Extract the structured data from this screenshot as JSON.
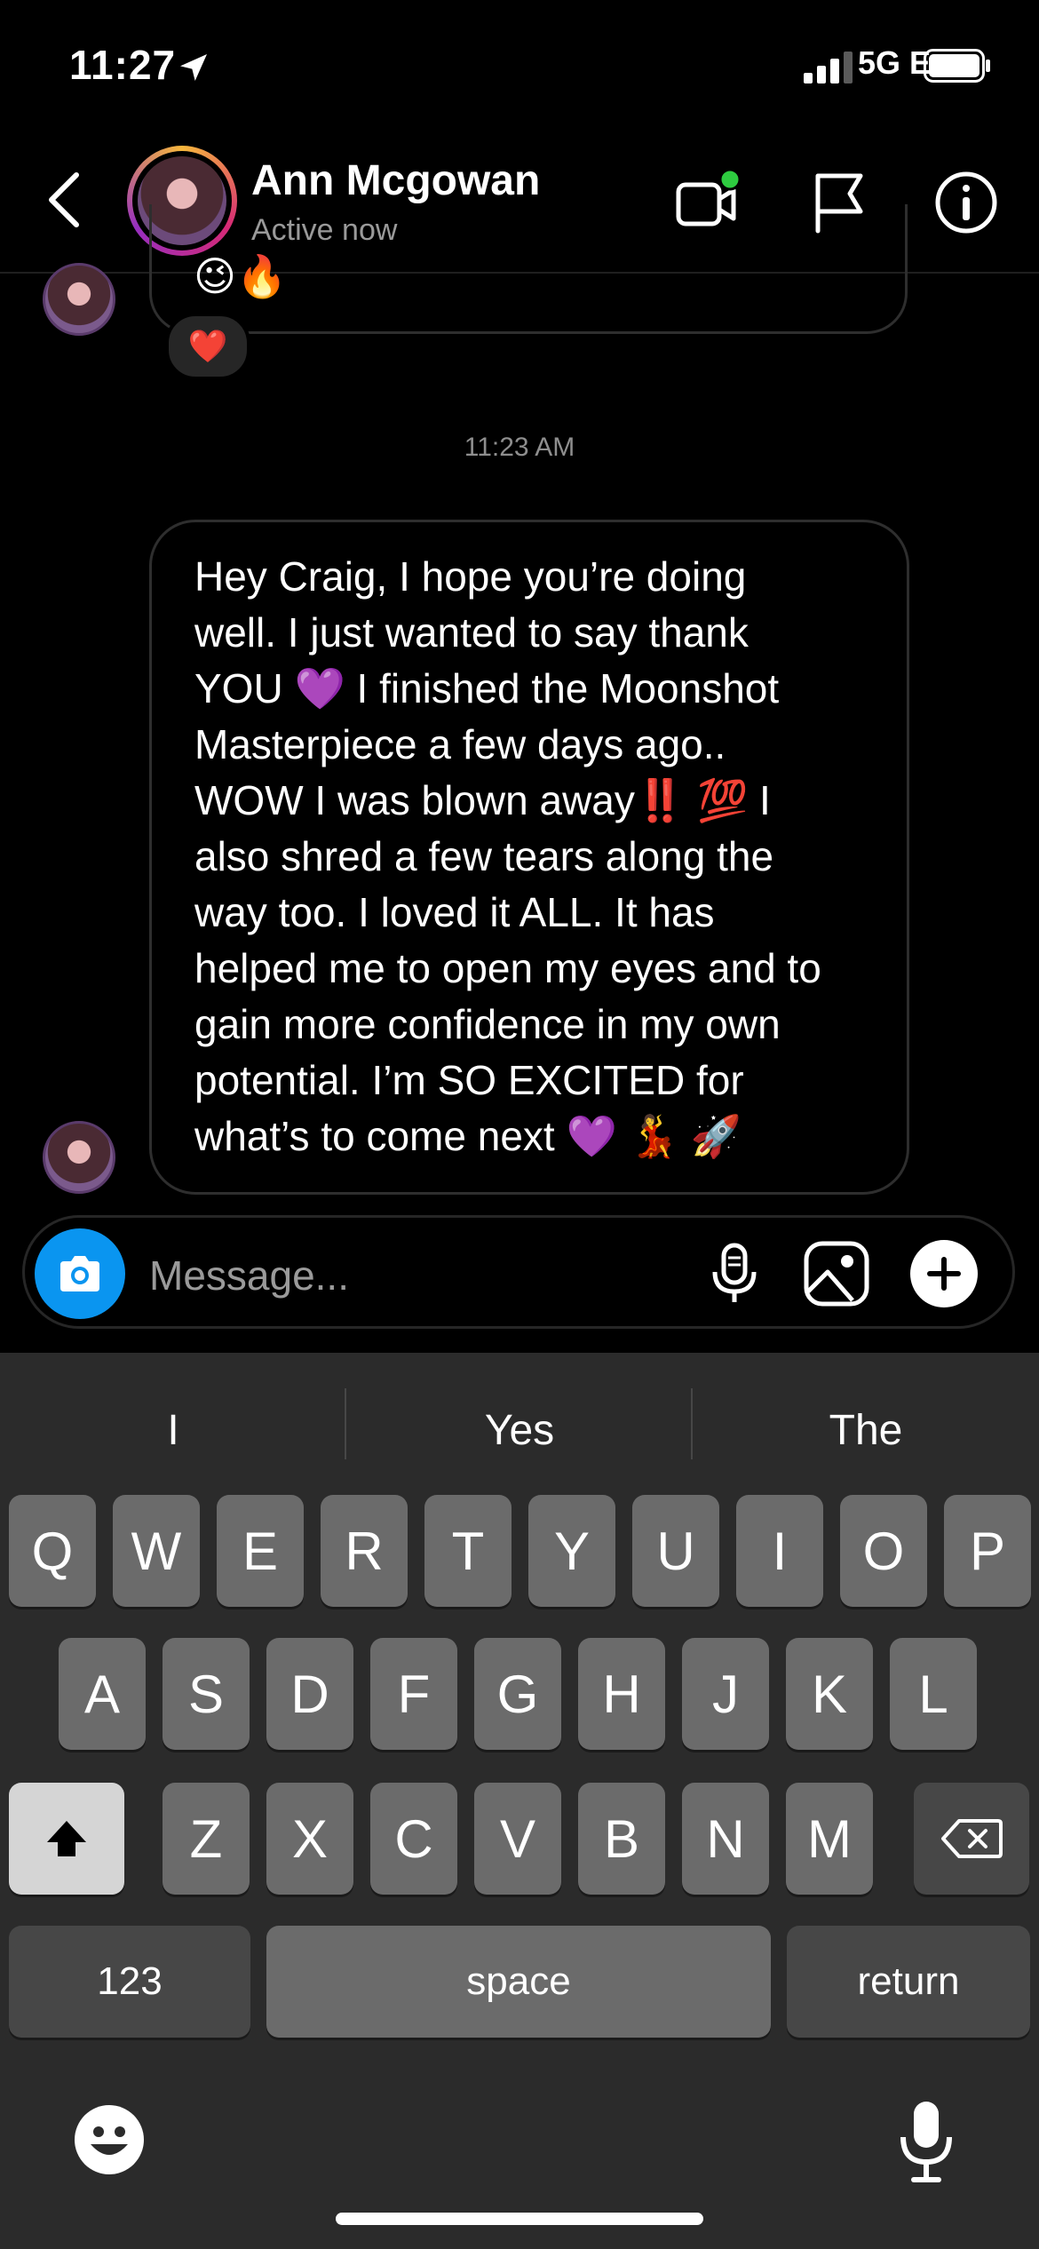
{
  "status_bar": {
    "time": "11:27",
    "network": "5G E"
  },
  "header": {
    "contact_name": "Ann Mcgowan",
    "contact_status": "Active now"
  },
  "conversation": {
    "previous_message": {
      "emojis": "😉🔥",
      "reaction": "❤️"
    },
    "timestamp": "11:23 AM",
    "message": {
      "text": "Hey Craig, I hope you’re doing\nwell. I just wanted to say thank\nYOU 💜 I finished the Moonshot\nMasterpiece a few days ago..\nWOW I was blown away‼️ 💯 I\nalso shred a few tears along the\nway too. I loved it ALL. It has\nhelped me to open my eyes and to\ngain more confidence in my own\npotential. I’m SO EXCITED for\nwhat’s to come next 💜 💃 🚀"
    }
  },
  "composer": {
    "placeholder": "Message..."
  },
  "keyboard": {
    "suggestions": [
      "I",
      "Yes",
      "The"
    ],
    "row1": [
      "Q",
      "W",
      "E",
      "R",
      "T",
      "Y",
      "U",
      "I",
      "O",
      "P"
    ],
    "row2": [
      "A",
      "S",
      "D",
      "F",
      "G",
      "H",
      "J",
      "K",
      "L"
    ],
    "row3": [
      "Z",
      "X",
      "C",
      "V",
      "B",
      "N",
      "M"
    ],
    "numbers_label": "123",
    "space_label": "space",
    "return_label": "return"
  },
  "icons": {
    "status_arrow": "location-arrow-icon",
    "back": "chevron-left-icon",
    "video": "video-camera-icon",
    "flag": "flag-icon",
    "info": "info-icon",
    "camera": "camera-icon",
    "mic": "microphone-icon",
    "gallery": "image-icon",
    "plus": "plus-icon",
    "shift": "shift-icon",
    "delete": "backspace-icon",
    "emoji": "emoji-icon",
    "dictation": "microphone-icon"
  },
  "colors": {
    "accent_blue": "#0a95f0",
    "online_dot": "#2ecc40",
    "background": "#000000",
    "keyboard_bg": "#2b2b2b"
  }
}
